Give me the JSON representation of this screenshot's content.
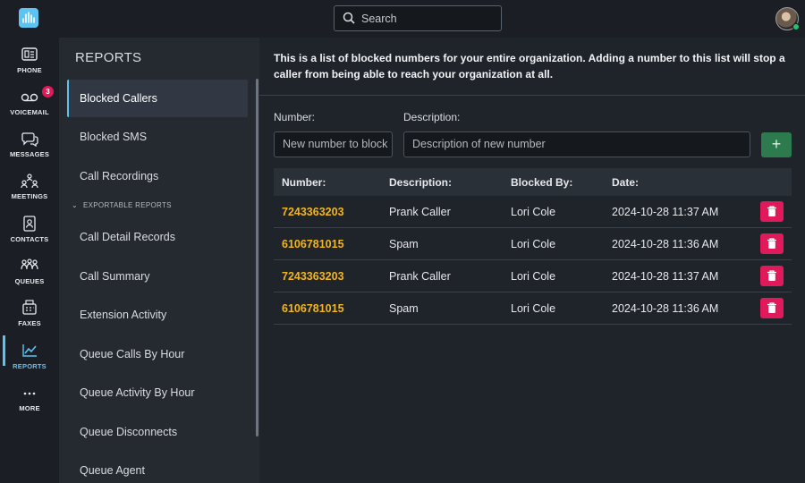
{
  "search": {
    "placeholder": "Search"
  },
  "nav": [
    {
      "label": "PHONE",
      "icon": "phone-icon"
    },
    {
      "label": "VOICEMAIL",
      "icon": "voicemail-icon",
      "badge": "3"
    },
    {
      "label": "MESSAGES",
      "icon": "messages-icon"
    },
    {
      "label": "MEETINGS",
      "icon": "meetings-icon"
    },
    {
      "label": "CONTACTS",
      "icon": "contacts-icon"
    },
    {
      "label": "QUEUES",
      "icon": "queues-icon"
    },
    {
      "label": "FAXES",
      "icon": "fax-icon"
    },
    {
      "label": "REPORTS",
      "icon": "reports-icon",
      "active": true
    },
    {
      "label": "MORE",
      "icon": "more-icon"
    }
  ],
  "sidebar": {
    "title": "REPORTS",
    "items": [
      {
        "label": "Blocked Callers",
        "active": true
      },
      {
        "label": "Blocked SMS"
      },
      {
        "label": "Call Recordings"
      }
    ],
    "section_label": "EXPORTABLE REPORTS",
    "exportable": [
      {
        "label": "Call Detail Records"
      },
      {
        "label": "Call Summary"
      },
      {
        "label": "Extension Activity"
      },
      {
        "label": "Queue Calls By Hour"
      },
      {
        "label": "Queue Activity By Hour"
      },
      {
        "label": "Queue Disconnects"
      },
      {
        "label": "Queue Agent"
      }
    ]
  },
  "main": {
    "info": "This is a list of blocked numbers for your entire organization. Adding a number to this list will stop a caller from being able to reach your organization at all.",
    "form": {
      "number_label": "Number:",
      "number_placeholder": "New number to block",
      "description_label": "Description:",
      "description_placeholder": "Description of new number",
      "add_label": "+"
    },
    "table": {
      "headers": [
        "Number:",
        "Description:",
        "Blocked By:",
        "Date:"
      ],
      "rows": [
        {
          "number": "7243363203",
          "description": "Prank Caller",
          "blocked_by": "Lori Cole",
          "date": "2024-10-28 11:37 AM"
        },
        {
          "number": "6106781015",
          "description": "Spam",
          "blocked_by": "Lori Cole",
          "date": "2024-10-28 11:36 AM"
        },
        {
          "number": "7243363203",
          "description": "Prank Caller",
          "blocked_by": "Lori Cole",
          "date": "2024-10-28 11:37 AM"
        },
        {
          "number": "6106781015",
          "description": "Spam",
          "blocked_by": "Lori Cole",
          "date": "2024-10-28 11:36 AM"
        }
      ]
    }
  },
  "colors": {
    "accent": "#5cc3f2",
    "number": "#f2b51d",
    "delete": "#e0195a",
    "add": "#2e7a4f"
  }
}
